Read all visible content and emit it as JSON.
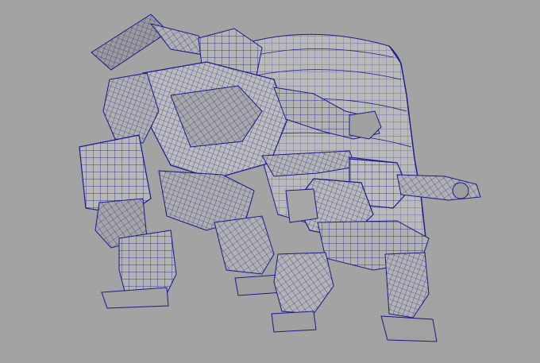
{
  "viewport": {
    "title": "",
    "background_color": "#a3a3a3",
    "wire_color": "#1a1a8c",
    "mesh_fill_color": "#b4b4b4",
    "mesh_shade_color": "#8c8c8c",
    "backdrop_fill_color": "#b9b9b9",
    "display_mode": "wireframe-on-shaded",
    "subjects": [
      "large-mech",
      "small-mech",
      "cylindrical-backdrop"
    ]
  }
}
